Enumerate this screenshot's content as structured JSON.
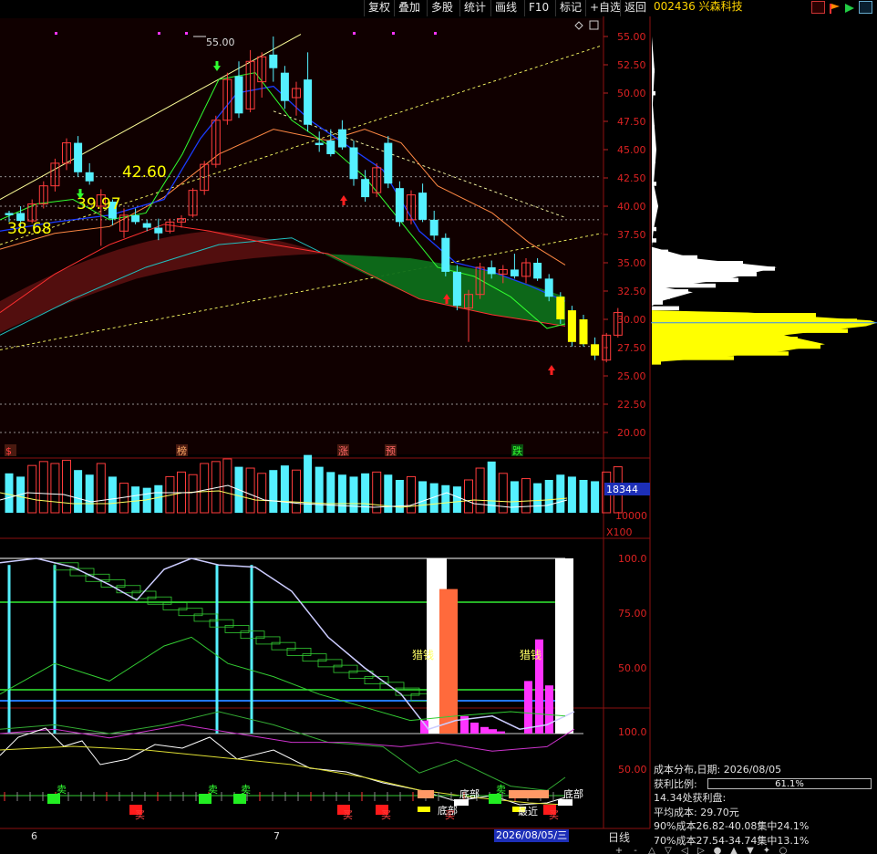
{
  "menu": [
    "复权",
    "叠加",
    "多股",
    "统计",
    "画线",
    "F10",
    "标记",
    "+自选",
    "返回"
  ],
  "stock": {
    "code": "002436",
    "name": "兴森科技"
  },
  "price_axis": [
    "55.00",
    "52.50",
    "50.00",
    "47.50",
    "45.00",
    "42.50",
    "40.00",
    "37.50",
    "35.00",
    "32.50",
    "30.00",
    "27.50",
    "25.00",
    "22.50",
    "20.00"
  ],
  "annotations": {
    "high": "55.00",
    "p1": "38.68",
    "p2": "39.97",
    "p3": "42.60"
  },
  "event_tags": [
    "$",
    "榜",
    "涨",
    "预",
    "跌"
  ],
  "volume": {
    "value": "18344",
    "axis": "10000",
    "unit": "X100"
  },
  "ind1_axis": [
    "100.0",
    "75.00",
    "50.00"
  ],
  "ind1_labels": [
    "猎钱",
    "猎钱"
  ],
  "ind2_axis": [
    "100.0",
    "50.00"
  ],
  "ind2_labels": [
    "卖",
    "卖",
    "卖",
    "卖",
    "底部",
    "底部",
    "底部",
    "买",
    "买",
    "买",
    "买",
    "买",
    "最近"
  ],
  "months": [
    "6",
    "7"
  ],
  "date_label": "2026/08/05/三",
  "period": "日线",
  "bottom_controls": [
    "+",
    "-",
    "△",
    "▽",
    "◁",
    "▷",
    "●",
    "▲",
    "▼",
    "✦",
    "○"
  ],
  "cost": {
    "line1": "成本分布,日期:  2026/08/05",
    "profit_label": "获利比例:",
    "profit_value": "61.1%",
    "line3": "14.34处获利盘:",
    "avg": "平均成本: 29.70元",
    "c90": "90%成本26.82-40.08集中24.1%",
    "c70": "70%成本27.54-34.74集中13.1%"
  },
  "candles": [
    {
      "o": 39.2,
      "h": 39.6,
      "l": 38.6,
      "c": 39.4,
      "up": false
    },
    {
      "o": 39.4,
      "h": 40.0,
      "l": 38.2,
      "c": 38.7,
      "up": false
    },
    {
      "o": 38.7,
      "h": 40.6,
      "l": 38.5,
      "c": 40.2,
      "up": true
    },
    {
      "o": 40.2,
      "h": 42.2,
      "l": 39.8,
      "c": 41.8,
      "up": true
    },
    {
      "o": 41.8,
      "h": 44.2,
      "l": 41.3,
      "c": 43.8,
      "up": true
    },
    {
      "o": 43.8,
      "h": 46.0,
      "l": 43.2,
      "c": 45.6,
      "up": true
    },
    {
      "o": 45.6,
      "h": 46.2,
      "l": 42.6,
      "c": 43.0,
      "up": false
    },
    {
      "o": 43.0,
      "h": 43.8,
      "l": 41.9,
      "c": 42.2,
      "up": false
    },
    {
      "o": 40.0,
      "h": 41.5,
      "l": 36.5,
      "c": 41.0,
      "up": true
    },
    {
      "o": 40.4,
      "h": 40.6,
      "l": 38.3,
      "c": 38.9,
      "up": false
    },
    {
      "o": 37.8,
      "h": 39.8,
      "l": 37.2,
      "c": 39.2,
      "up": true
    },
    {
      "o": 39.2,
      "h": 39.8,
      "l": 38.4,
      "c": 38.6,
      "up": false
    },
    {
      "o": 38.5,
      "h": 38.8,
      "l": 37.8,
      "c": 38.1,
      "up": false
    },
    {
      "o": 38.1,
      "h": 38.9,
      "l": 37.0,
      "c": 37.6,
      "up": false
    },
    {
      "o": 37.8,
      "h": 38.9,
      "l": 37.6,
      "c": 38.6,
      "up": true
    },
    {
      "o": 38.6,
      "h": 39.2,
      "l": 38.1,
      "c": 38.9,
      "up": true
    },
    {
      "o": 39.2,
      "h": 41.6,
      "l": 39.0,
      "c": 41.4,
      "up": true
    },
    {
      "o": 41.4,
      "h": 44.0,
      "l": 41.0,
      "c": 43.7,
      "up": true
    },
    {
      "o": 43.7,
      "h": 48.0,
      "l": 43.4,
      "c": 47.6,
      "up": true
    },
    {
      "o": 47.6,
      "h": 51.8,
      "l": 47.2,
      "c": 51.2,
      "up": true
    },
    {
      "o": 51.5,
      "h": 52.8,
      "l": 47.8,
      "c": 48.2,
      "up": false
    },
    {
      "o": 48.6,
      "h": 53.8,
      "l": 48.3,
      "c": 52.8,
      "up": true
    },
    {
      "o": 51.0,
      "h": 53.6,
      "l": 49.6,
      "c": 53.2,
      "up": true
    },
    {
      "o": 53.4,
      "h": 55.0,
      "l": 51.0,
      "c": 52.2,
      "up": false
    },
    {
      "o": 51.8,
      "h": 52.4,
      "l": 48.6,
      "c": 49.3,
      "up": false
    },
    {
      "o": 49.6,
      "h": 51.0,
      "l": 48.0,
      "c": 50.4,
      "up": true
    },
    {
      "o": 51.2,
      "h": 53.6,
      "l": 46.6,
      "c": 47.2,
      "up": false
    },
    {
      "o": 45.6,
      "h": 46.6,
      "l": 44.8,
      "c": 45.4,
      "up": false
    },
    {
      "o": 45.8,
      "h": 46.8,
      "l": 44.4,
      "c": 44.6,
      "up": false
    },
    {
      "o": 46.8,
      "h": 47.6,
      "l": 45.0,
      "c": 45.2,
      "up": false
    },
    {
      "o": 45.2,
      "h": 45.8,
      "l": 41.8,
      "c": 42.4,
      "up": false
    },
    {
      "o": 42.4,
      "h": 43.2,
      "l": 40.4,
      "c": 40.8,
      "up": false
    },
    {
      "o": 41.2,
      "h": 43.8,
      "l": 40.8,
      "c": 43.4,
      "up": true
    },
    {
      "o": 45.6,
      "h": 46.2,
      "l": 41.6,
      "c": 42.0,
      "up": false
    },
    {
      "o": 41.6,
      "h": 42.2,
      "l": 38.2,
      "c": 38.6,
      "up": false
    },
    {
      "o": 38.8,
      "h": 41.4,
      "l": 38.4,
      "c": 41.0,
      "up": true
    },
    {
      "o": 41.2,
      "h": 42.0,
      "l": 38.6,
      "c": 38.8,
      "up": false
    },
    {
      "o": 38.8,
      "h": 39.6,
      "l": 37.0,
      "c": 37.4,
      "up": false
    },
    {
      "o": 37.2,
      "h": 37.6,
      "l": 33.8,
      "c": 34.2,
      "up": false
    },
    {
      "o": 34.2,
      "h": 34.8,
      "l": 30.8,
      "c": 31.2,
      "up": false
    },
    {
      "o": 31.0,
      "h": 32.6,
      "l": 28.0,
      "c": 32.2,
      "up": true
    },
    {
      "o": 32.2,
      "h": 35.0,
      "l": 31.8,
      "c": 34.6,
      "up": true
    },
    {
      "o": 34.6,
      "h": 35.2,
      "l": 33.6,
      "c": 34.0,
      "up": false
    },
    {
      "o": 34.0,
      "h": 34.8,
      "l": 33.2,
      "c": 34.4,
      "up": true
    },
    {
      "o": 34.4,
      "h": 35.8,
      "l": 33.6,
      "c": 33.8,
      "up": false
    },
    {
      "o": 33.8,
      "h": 35.4,
      "l": 33.2,
      "c": 35.0,
      "up": true
    },
    {
      "o": 35.0,
      "h": 35.4,
      "l": 33.4,
      "c": 33.6,
      "up": false
    },
    {
      "o": 33.6,
      "h": 34.0,
      "l": 31.6,
      "c": 32.0,
      "up": false
    },
    {
      "o": 32.0,
      "h": 32.4,
      "l": 29.6,
      "c": 30.0,
      "up": false
    },
    {
      "o": 30.8,
      "h": 31.2,
      "l": 27.6,
      "c": 28.0,
      "up": false
    },
    {
      "o": 30.0,
      "h": 30.4,
      "l": 27.6,
      "c": 27.8,
      "up": false
    },
    {
      "o": 27.8,
      "h": 28.4,
      "l": 26.4,
      "c": 26.8,
      "up": false
    },
    {
      "o": 26.4,
      "h": 28.8,
      "l": 26.2,
      "c": 28.6,
      "up": true
    },
    {
      "o": 28.6,
      "h": 31.0,
      "l": 28.4,
      "c": 30.6,
      "up": true
    }
  ],
  "volumes": [
    60,
    55,
    72,
    78,
    75,
    80,
    65,
    58,
    75,
    55,
    45,
    40,
    38,
    42,
    55,
    62,
    58,
    75,
    78,
    82,
    70,
    68,
    60,
    65,
    72,
    65,
    88,
    70,
    62,
    58,
    55,
    60,
    62,
    58,
    50,
    55,
    48,
    45,
    42,
    40,
    50,
    68,
    78,
    60,
    48,
    52,
    45,
    50,
    58,
    55,
    50,
    48,
    62,
    70
  ],
  "cost_profile": [
    {
      "p": 29.7,
      "w": 240,
      "c": "#ffff00"
    },
    {
      "p": 29.0,
      "w": 215,
      "c": "#ffff00"
    },
    {
      "p": 29.9,
      "w": 225,
      "c": "#ffff00"
    },
    {
      "p": 30.4,
      "w": 180,
      "c": "#ffff00"
    },
    {
      "p": 28.3,
      "w": 160,
      "c": "#ffff00"
    },
    {
      "p": 27.6,
      "w": 185,
      "c": "#ffff00"
    },
    {
      "p": 27.0,
      "w": 150,
      "c": "#ffff00"
    },
    {
      "p": 26.6,
      "w": 90,
      "c": "#ffff00"
    },
    {
      "p": 26.2,
      "w": 10,
      "c": "#ffff00"
    },
    {
      "p": 31.0,
      "w": 30,
      "c": "#ffffff"
    },
    {
      "p": 31.5,
      "w": 12,
      "c": "#ffffff"
    },
    {
      "p": 32.0,
      "w": 20,
      "c": "#ffffff"
    },
    {
      "p": 32.5,
      "w": 40,
      "c": "#ffffff"
    },
    {
      "p": 33.0,
      "w": 70,
      "c": "#ffffff"
    },
    {
      "p": 33.5,
      "w": 95,
      "c": "#ffffff"
    },
    {
      "p": 34.0,
      "w": 115,
      "c": "#ffffff"
    },
    {
      "p": 34.5,
      "w": 135,
      "c": "#ffffff"
    },
    {
      "p": 35.0,
      "w": 100,
      "c": "#ffffff"
    },
    {
      "p": 35.5,
      "w": 50,
      "c": "#ffffff"
    },
    {
      "p": 36.0,
      "w": 18,
      "c": "#ffffff"
    },
    {
      "p": 37.0,
      "w": 5,
      "c": "#ffffff"
    },
    {
      "p": 38.0,
      "w": 5,
      "c": "#ffffff"
    },
    {
      "p": 40.0,
      "w": 6,
      "c": "#ffffff"
    },
    {
      "p": 42.0,
      "w": 5,
      "c": "#ffffff"
    },
    {
      "p": 44.0,
      "w": 4,
      "c": "#ffffff"
    },
    {
      "p": 45.0,
      "w": 4,
      "c": "#ffffff"
    },
    {
      "p": 47.0,
      "w": 3,
      "c": "#ffffff"
    },
    {
      "p": 50.0,
      "w": 4,
      "c": "#ffffff"
    },
    {
      "p": 52.0,
      "w": 3,
      "c": "#ffffff"
    }
  ]
}
